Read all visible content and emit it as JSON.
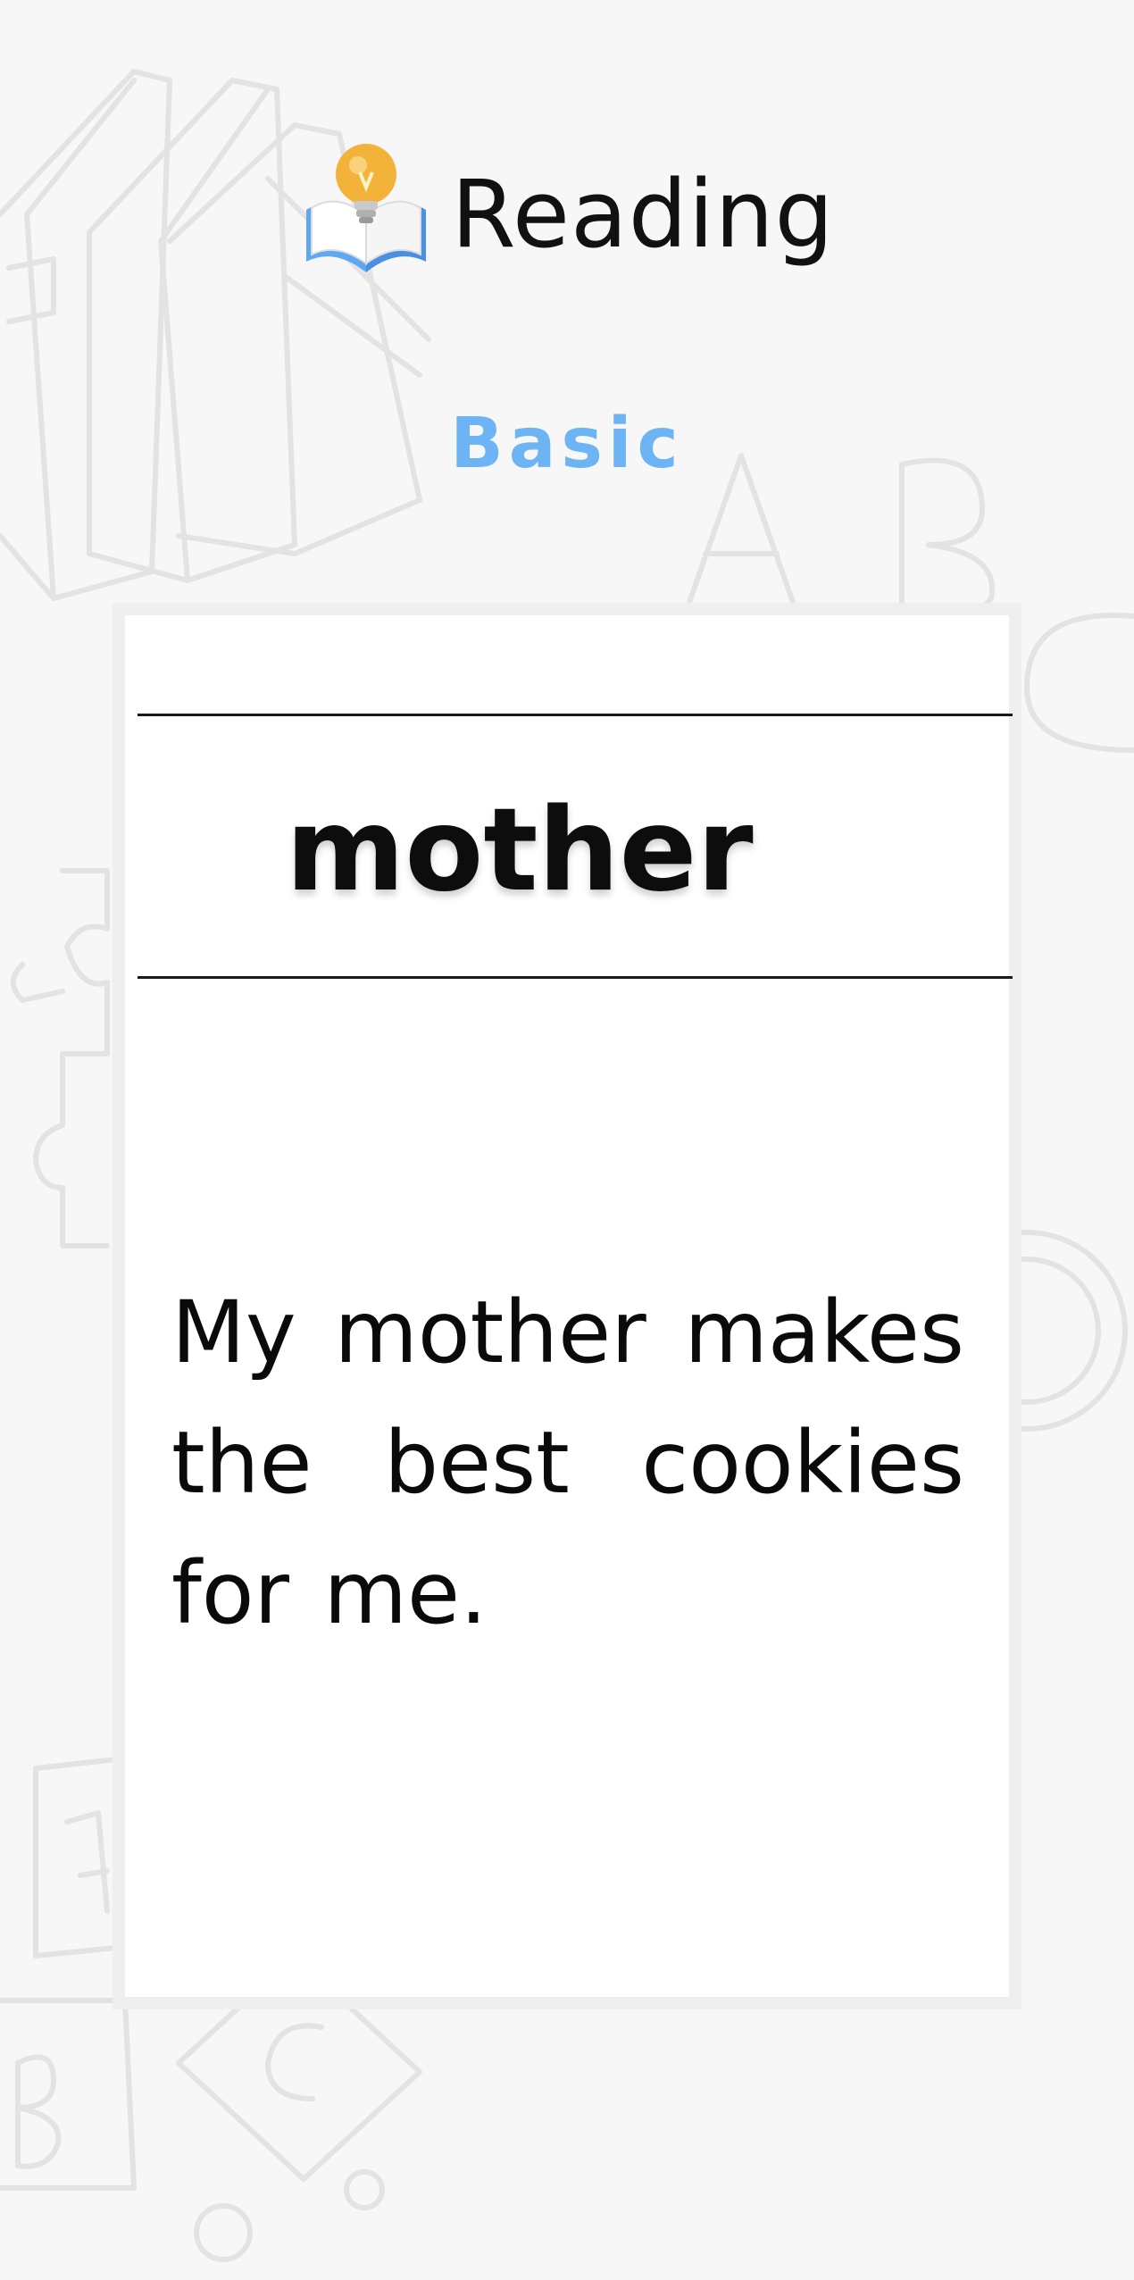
{
  "header": {
    "title": "Reading",
    "logo_icon": "open-book-lightbulb-icon"
  },
  "level": {
    "label": "Basic",
    "color": "#6db4f5"
  },
  "card": {
    "word": "mother",
    "sentence": "My mother makes the best cookies for me."
  }
}
